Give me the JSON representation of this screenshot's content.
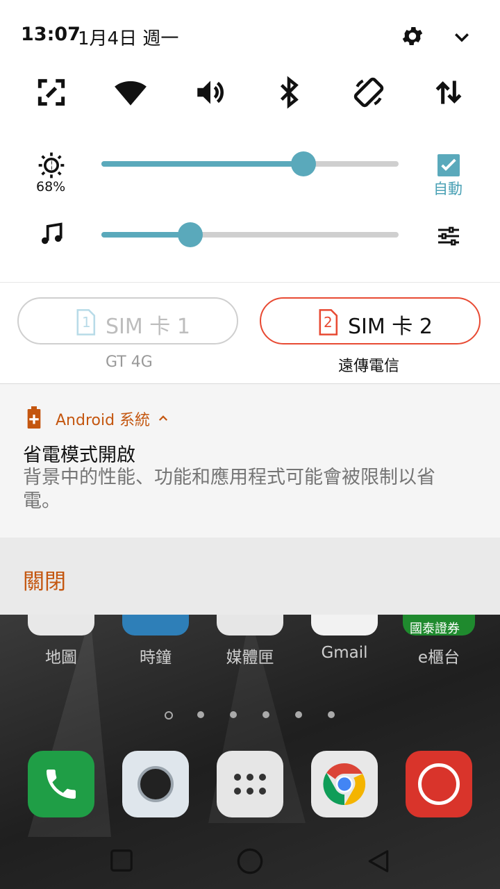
{
  "status": {
    "time": "13:07",
    "date": "1月4日 週一"
  },
  "quick_tiles": [
    "screen-capture-icon",
    "wifi-icon",
    "volume-icon",
    "bluetooth-icon",
    "auto-rotate-icon",
    "mobile-data-icon"
  ],
  "brightness": {
    "level_percent": 68,
    "label": "68%",
    "auto_label": "自動",
    "auto_checked": true
  },
  "media_volume": {
    "level_percent": 30
  },
  "sim": {
    "sim1": {
      "label": "SIM 卡 1",
      "badge": "1",
      "carrier": "GT 4G"
    },
    "sim2": {
      "label": "SIM 卡 2",
      "badge": "2",
      "carrier": "遠傳電信"
    }
  },
  "notification": {
    "app_name": "Android 系統",
    "title": "省電模式開啟",
    "body": "背景中的性能、功能和應用程式可能會被限制以省電。",
    "action_label": "關閉"
  },
  "home": {
    "apps": [
      "地圖",
      "時鐘",
      "媒體匣",
      "Gmail",
      "e櫃台"
    ],
    "cathay_badge": "國泰證券",
    "page_count": 6,
    "current_page": 1
  },
  "colors": {
    "accent": "#5aa9bb",
    "notification_orange": "#c4560f",
    "sim2_red": "#e84a33"
  }
}
